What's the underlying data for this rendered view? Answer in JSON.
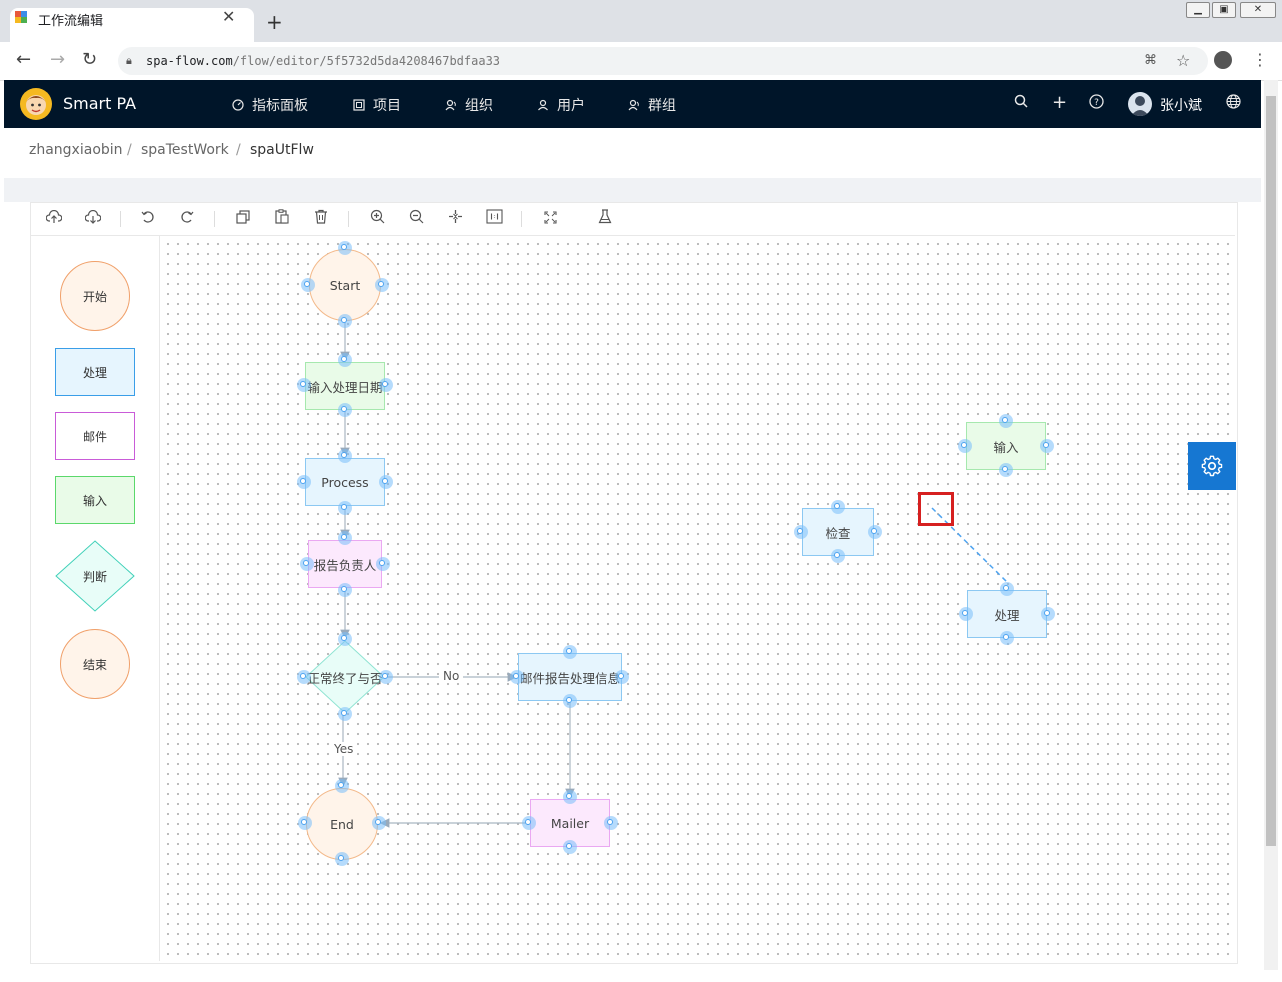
{
  "browser": {
    "tab_title": "工作流编辑",
    "new_tab_label": "+",
    "url_host": "spa-flow.com",
    "url_path": "/flow/editor/5f5732d5da4208467bdfaa33"
  },
  "app": {
    "brand": "Smart PA",
    "nav": [
      {
        "label": "指标面板",
        "icon": "dashboard-icon"
      },
      {
        "label": "项目",
        "icon": "project-icon"
      },
      {
        "label": "组织",
        "icon": "org-icon"
      },
      {
        "label": "用户",
        "icon": "user-icon"
      },
      {
        "label": "群组",
        "icon": "group-icon"
      }
    ],
    "username": "张小斌"
  },
  "breadcrumb": [
    "zhangxiaobin",
    "spaTestWork",
    "spaUtFlw"
  ],
  "breadcrumb_sep": "/",
  "palette": {
    "start": "开始",
    "process": "处理",
    "mail": "邮件",
    "input": "输入",
    "decision": "判断",
    "end": "结束"
  },
  "flow": {
    "start": "Start",
    "input_date": "输入处理日期",
    "process": "Process",
    "report_owner": "报告负责人",
    "decision": "正常终了与否",
    "mail_report": "邮件报告处理信息",
    "end": "End",
    "mailer": "Mailer",
    "label_no": "No",
    "label_yes": "Yes",
    "check": "检查",
    "input": "输入",
    "handle": "处理"
  },
  "colors": {
    "accent": "#1677d2",
    "header_bg": "#001529",
    "highlight": "#d62020"
  }
}
